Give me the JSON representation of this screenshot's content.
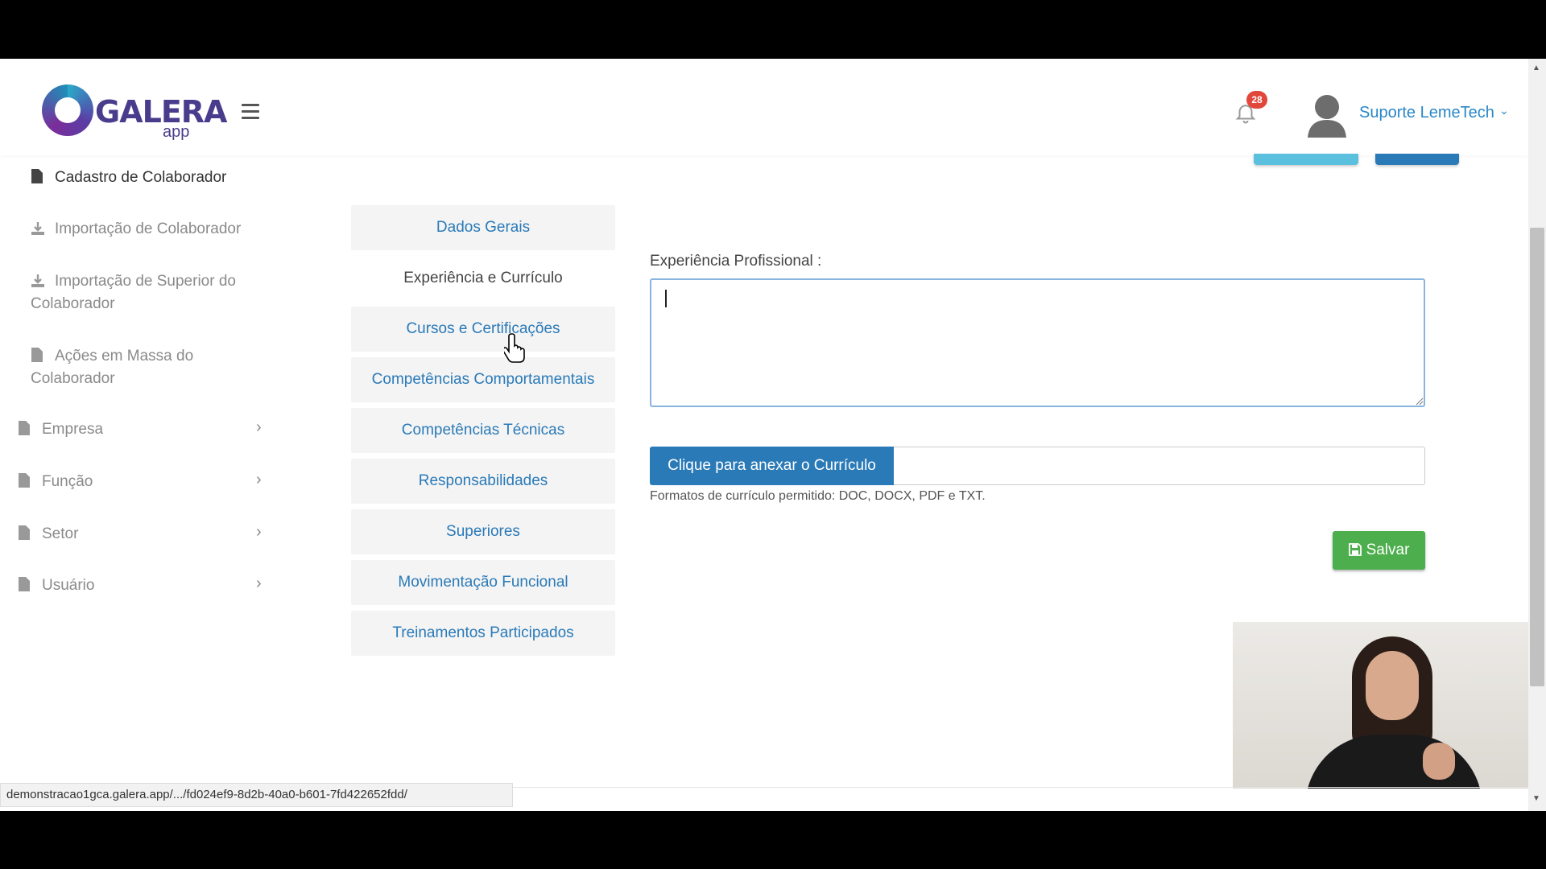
{
  "header": {
    "logo_text": "GALERA",
    "logo_sub": "app",
    "notification_count": "28",
    "user_name": "Suporte LemeTech"
  },
  "sidebar": {
    "items": [
      {
        "label": "Cadastro de Colaborador",
        "icon": "file-icon"
      },
      {
        "label": "Importação de Colaborador",
        "icon": "download-icon"
      },
      {
        "label": "Importação de Superior do Colaborador",
        "icon": "download-icon"
      },
      {
        "label": "Ações em Massa do Colaborador",
        "icon": "file-icon"
      },
      {
        "label": "Empresa",
        "icon": "file-icon"
      },
      {
        "label": "Função",
        "icon": "file-icon"
      },
      {
        "label": "Setor",
        "icon": "file-icon"
      },
      {
        "label": "Usuário",
        "icon": "file-icon"
      }
    ]
  },
  "tabs": [
    {
      "label": "Dados Gerais"
    },
    {
      "label": "Experiência e Currículo"
    },
    {
      "label": "Cursos e Certificações"
    },
    {
      "label": "Competências Comportamentais"
    },
    {
      "label": "Competências Técnicas"
    },
    {
      "label": "Responsabilidades"
    },
    {
      "label": "Superiores"
    },
    {
      "label": "Movimentação Funcional"
    },
    {
      "label": "Treinamentos Participados"
    }
  ],
  "form": {
    "experience_label": "Experiência Profissional :",
    "experience_value": "",
    "attach_button": "Clique para anexar o Currículo",
    "formats_note": "Formatos de currículo permitido: DOC, DOCX, PDF e TXT.",
    "save_button": "Salvar"
  },
  "statusbar": {
    "url": "demonstracao1gca.galera.app/.../fd024ef9-8d2b-40a0-b601-7fd422652fdd/"
  },
  "colors": {
    "primary": "#2a7ab8",
    "success": "#4cae4c",
    "badge": "#e2473b",
    "link": "#2a87c8"
  }
}
